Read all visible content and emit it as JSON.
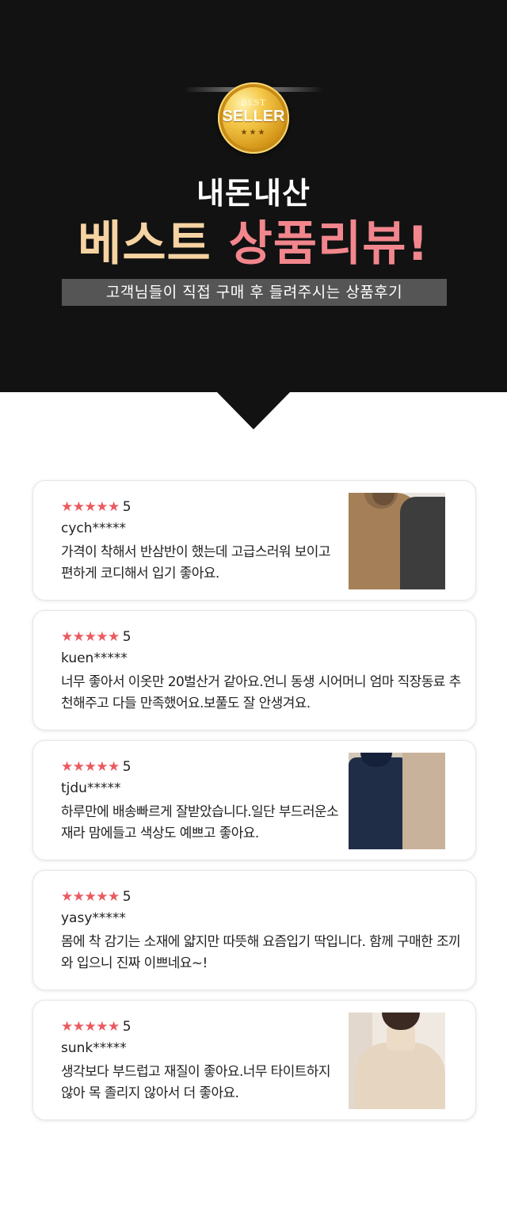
{
  "header": {
    "badge_top": "BEST",
    "badge_main": "SELLER",
    "badge_stars": "★★★",
    "brand": "내돈내산",
    "title_part1": "베스트",
    "title_part2": "상품리뷰!",
    "subtitle": "고객님들이 직접 구매 후 들려주시는 상품후기"
  },
  "colors": {
    "hero_bg": "#121212",
    "title_part1": "#f6d3a2",
    "title_part2": "#f2868d",
    "star": "#ea5a5f"
  },
  "reviews": [
    {
      "stars": "★★★★★",
      "score": "5",
      "user": "cych*****",
      "text": "가격이 착해서 반삼반이 했는데 고급스러워 보이고 편하게 코디해서 입기 좋아요.",
      "thumbnail": "brown-turtleneck-photo"
    },
    {
      "stars": "★★★★★",
      "score": "5",
      "user": "kuen*****",
      "text": "너무 좋아서 이옷만 20벌산거 같아요.언니 동생 시어머니 엄마 직장동료 추천해주고 다들 만족했어요.보풀도 잘 안생겨요."
    },
    {
      "stars": "★★★★★",
      "score": "5",
      "user": "tjdu*****",
      "text": "하루만에 배송빠르게 잘받았습니다.일단 부드러운소재라 맘에들고 색상도 예쁘고 좋아요.",
      "thumbnail": "navy-beige-turtleneck-photo"
    },
    {
      "stars": "★★★★★",
      "score": "5",
      "user": "yasy*****",
      "text": "몸에 착 감기는 소재에 얇지만 따뜻해 요즘입기 딱입니다. 함께 구매한 조끼와 입으니 진짜 이쁘네요~!"
    },
    {
      "stars": "★★★★★",
      "score": "5",
      "user": "sunk*****",
      "text": "생각보다 부드럽고 재질이 좋아요.너무 타이트하지 않아 목 졸리지 않아서 더 좋아요.",
      "thumbnail": "cream-turtleneck-photo"
    }
  ]
}
